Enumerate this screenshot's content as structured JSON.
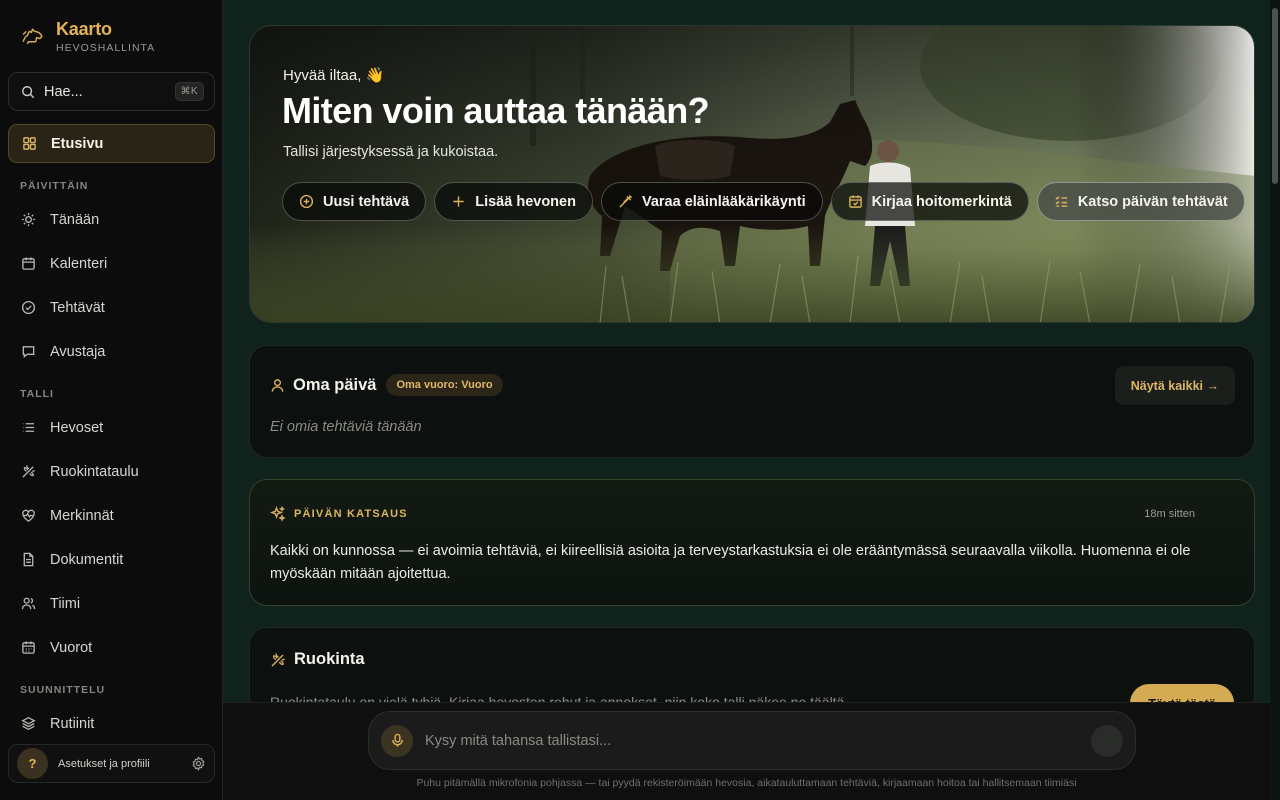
{
  "app": {
    "name": "Kaarto",
    "subtitle": "HEVOSHALLINTA"
  },
  "search": {
    "placeholder": "Hae...",
    "shortcut": "⌘K"
  },
  "nav": {
    "home": "Etusivu",
    "sections": {
      "daily": "PÄIVITTÄIN",
      "stable": "TALLI",
      "planning": "SUUNNITTELU"
    },
    "daily": [
      "Tänään",
      "Kalenteri",
      "Tehtävät",
      "Avustaja"
    ],
    "stable": [
      "Hevoset",
      "Ruokintataulu",
      "Merkinnät",
      "Dokumentit",
      "Tiimi",
      "Vuorot"
    ],
    "planning": [
      "Rutiinit"
    ]
  },
  "profile": {
    "avatar": "?",
    "label": "Asetukset ja profiili"
  },
  "hero": {
    "greeting": "Hyvää iltaa, 👋",
    "title": "Miten voin auttaa tänään?",
    "subtitle": "Tallisi järjestyksessä ja kukoistaa.",
    "actions": [
      "Uusi tehtävä",
      "Lisää hevonen",
      "Varaa eläinlääkärikäynti",
      "Kirjaa hoitomerkintä",
      "Katso päivän tehtävät"
    ]
  },
  "my_day": {
    "title": "Oma päivä",
    "badge": "Oma vuoro: Vuoro",
    "show_all": "Näytä kaikki →",
    "empty": "Ei omia tehtäviä tänään"
  },
  "insight": {
    "label": "PÄIVÄN KATSAUS",
    "time": "18m sitten",
    "text": "Kaikki on kunnossa — ei avoimia tehtäviä, ei kiireellisiä asioita ja terveystarkastuksia ei ole erääntymässä seuraavalla viikolla. Huomenna ei ole myöskään mitään ajoitettua."
  },
  "feeding": {
    "title": "Ruokinta",
    "text": "Ruokintataulu on vielä tyhjä. Kirjaa hevosten rehut ja annokset, niin koko talli näkee ne täältä.",
    "button": "Täytä tästä"
  },
  "composer": {
    "placeholder": "Kysy mitä tahansa tallistasi...",
    "hint": "Puhu pitämällä mikrofonia pohjassa — tai pyydä rekisteröimään hevosia, aikatauluttamaan tehtäviä, kirjaamaan hoitoa tai hallitsemaan tiimiäsi"
  },
  "colors": {
    "accent": "#d9b05b",
    "sidebar_bg": "#0c0c0c",
    "main_bg": "#0f221b"
  }
}
